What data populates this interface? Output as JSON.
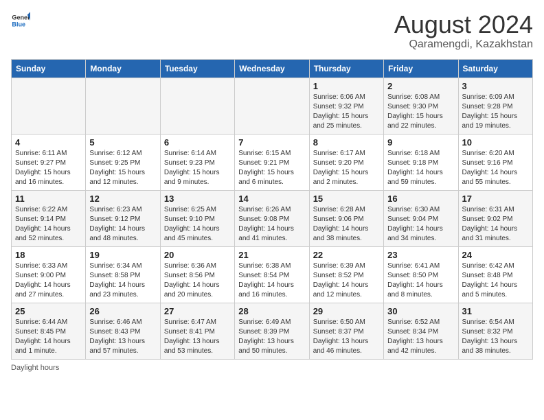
{
  "logo": {
    "general": "General",
    "blue": "Blue"
  },
  "title": "August 2024",
  "subtitle": "Qaramengdi, Kazakhstan",
  "days_of_week": [
    "Sunday",
    "Monday",
    "Tuesday",
    "Wednesday",
    "Thursday",
    "Friday",
    "Saturday"
  ],
  "weeks": [
    [
      {
        "day": "",
        "info": ""
      },
      {
        "day": "",
        "info": ""
      },
      {
        "day": "",
        "info": ""
      },
      {
        "day": "",
        "info": ""
      },
      {
        "day": "1",
        "info": "Sunrise: 6:06 AM\nSunset: 9:32 PM\nDaylight: 15 hours\nand 25 minutes."
      },
      {
        "day": "2",
        "info": "Sunrise: 6:08 AM\nSunset: 9:30 PM\nDaylight: 15 hours\nand 22 minutes."
      },
      {
        "day": "3",
        "info": "Sunrise: 6:09 AM\nSunset: 9:28 PM\nDaylight: 15 hours\nand 19 minutes."
      }
    ],
    [
      {
        "day": "4",
        "info": "Sunrise: 6:11 AM\nSunset: 9:27 PM\nDaylight: 15 hours\nand 16 minutes."
      },
      {
        "day": "5",
        "info": "Sunrise: 6:12 AM\nSunset: 9:25 PM\nDaylight: 15 hours\nand 12 minutes."
      },
      {
        "day": "6",
        "info": "Sunrise: 6:14 AM\nSunset: 9:23 PM\nDaylight: 15 hours\nand 9 minutes."
      },
      {
        "day": "7",
        "info": "Sunrise: 6:15 AM\nSunset: 9:21 PM\nDaylight: 15 hours\nand 6 minutes."
      },
      {
        "day": "8",
        "info": "Sunrise: 6:17 AM\nSunset: 9:20 PM\nDaylight: 15 hours\nand 2 minutes."
      },
      {
        "day": "9",
        "info": "Sunrise: 6:18 AM\nSunset: 9:18 PM\nDaylight: 14 hours\nand 59 minutes."
      },
      {
        "day": "10",
        "info": "Sunrise: 6:20 AM\nSunset: 9:16 PM\nDaylight: 14 hours\nand 55 minutes."
      }
    ],
    [
      {
        "day": "11",
        "info": "Sunrise: 6:22 AM\nSunset: 9:14 PM\nDaylight: 14 hours\nand 52 minutes."
      },
      {
        "day": "12",
        "info": "Sunrise: 6:23 AM\nSunset: 9:12 PM\nDaylight: 14 hours\nand 48 minutes."
      },
      {
        "day": "13",
        "info": "Sunrise: 6:25 AM\nSunset: 9:10 PM\nDaylight: 14 hours\nand 45 minutes."
      },
      {
        "day": "14",
        "info": "Sunrise: 6:26 AM\nSunset: 9:08 PM\nDaylight: 14 hours\nand 41 minutes."
      },
      {
        "day": "15",
        "info": "Sunrise: 6:28 AM\nSunset: 9:06 PM\nDaylight: 14 hours\nand 38 minutes."
      },
      {
        "day": "16",
        "info": "Sunrise: 6:30 AM\nSunset: 9:04 PM\nDaylight: 14 hours\nand 34 minutes."
      },
      {
        "day": "17",
        "info": "Sunrise: 6:31 AM\nSunset: 9:02 PM\nDaylight: 14 hours\nand 31 minutes."
      }
    ],
    [
      {
        "day": "18",
        "info": "Sunrise: 6:33 AM\nSunset: 9:00 PM\nDaylight: 14 hours\nand 27 minutes."
      },
      {
        "day": "19",
        "info": "Sunrise: 6:34 AM\nSunset: 8:58 PM\nDaylight: 14 hours\nand 23 minutes."
      },
      {
        "day": "20",
        "info": "Sunrise: 6:36 AM\nSunset: 8:56 PM\nDaylight: 14 hours\nand 20 minutes."
      },
      {
        "day": "21",
        "info": "Sunrise: 6:38 AM\nSunset: 8:54 PM\nDaylight: 14 hours\nand 16 minutes."
      },
      {
        "day": "22",
        "info": "Sunrise: 6:39 AM\nSunset: 8:52 PM\nDaylight: 14 hours\nand 12 minutes."
      },
      {
        "day": "23",
        "info": "Sunrise: 6:41 AM\nSunset: 8:50 PM\nDaylight: 14 hours\nand 8 minutes."
      },
      {
        "day": "24",
        "info": "Sunrise: 6:42 AM\nSunset: 8:48 PM\nDaylight: 14 hours\nand 5 minutes."
      }
    ],
    [
      {
        "day": "25",
        "info": "Sunrise: 6:44 AM\nSunset: 8:45 PM\nDaylight: 14 hours\nand 1 minute."
      },
      {
        "day": "26",
        "info": "Sunrise: 6:46 AM\nSunset: 8:43 PM\nDaylight: 13 hours\nand 57 minutes."
      },
      {
        "day": "27",
        "info": "Sunrise: 6:47 AM\nSunset: 8:41 PM\nDaylight: 13 hours\nand 53 minutes."
      },
      {
        "day": "28",
        "info": "Sunrise: 6:49 AM\nSunset: 8:39 PM\nDaylight: 13 hours\nand 50 minutes."
      },
      {
        "day": "29",
        "info": "Sunrise: 6:50 AM\nSunset: 8:37 PM\nDaylight: 13 hours\nand 46 minutes."
      },
      {
        "day": "30",
        "info": "Sunrise: 6:52 AM\nSunset: 8:34 PM\nDaylight: 13 hours\nand 42 minutes."
      },
      {
        "day": "31",
        "info": "Sunrise: 6:54 AM\nSunset: 8:32 PM\nDaylight: 13 hours\nand 38 minutes."
      }
    ]
  ],
  "footer": "Daylight hours"
}
